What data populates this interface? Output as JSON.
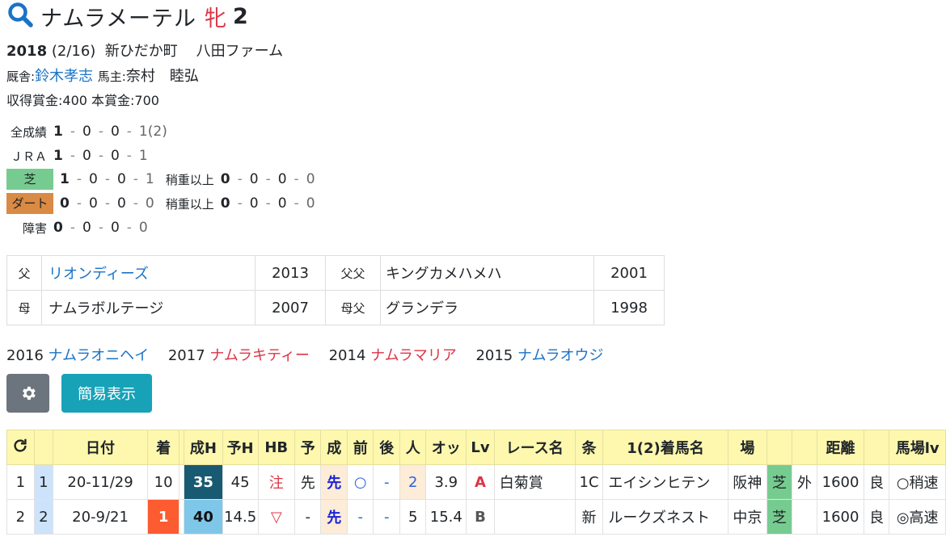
{
  "horse": {
    "name": "ナムラメーテル",
    "sex": "牝",
    "age": "2",
    "birth_year": "2018",
    "birth_date": "(2/16)",
    "birthplace": "新ひだか町",
    "breeder": "八田ファーム",
    "trainer_label": "厩舎:",
    "trainer": "鈴木孝志",
    "owner_label": "馬主:",
    "owner": "奈村　睦弘",
    "prize_line": "収得賞金:400 本賞金:700"
  },
  "records": [
    {
      "label": "全成績",
      "w": "1",
      "s": "0",
      "t": "0",
      "o": "1",
      "extra_o": " (2)"
    },
    {
      "label": "ＪＲＡ",
      "w": "1",
      "s": "0",
      "t": "0",
      "o": "1"
    },
    {
      "label": "芝",
      "w": "1",
      "s": "0",
      "t": "0",
      "o": "1",
      "sub_label": "稍重以上",
      "sw": "0",
      "ss": "0",
      "st": "0",
      "so": "0"
    },
    {
      "label": "ダート",
      "w": "0",
      "s": "0",
      "t": "0",
      "o": "0",
      "sub_label": "稍重以上",
      "sw": "0",
      "ss": "0",
      "st": "0",
      "so": "0"
    },
    {
      "label": "障害",
      "w": "0",
      "s": "0",
      "t": "0",
      "o": "0"
    }
  ],
  "pedigree": {
    "sire_label": "父",
    "sire": "リオンディーズ",
    "sire_year": "2013",
    "sire_sire_label": "父父",
    "sire_sire": "キングカメハメハ",
    "sire_sire_year": "2001",
    "dam_label": "母",
    "dam": "ナムラボルテージ",
    "dam_year": "2007",
    "dam_sire_label": "母父",
    "dam_sire": "グランデラ",
    "dam_sire_year": "1998"
  },
  "siblings": [
    {
      "year": "2016",
      "name": "ナムラオニヘイ",
      "color": "#1a73c7"
    },
    {
      "year": "2017",
      "name": "ナムラキティー",
      "color": "#dc3545"
    },
    {
      "year": "2014",
      "name": "ナムラマリア",
      "color": "#dc3545"
    },
    {
      "year": "2015",
      "name": "ナムラオウジ",
      "color": "#1a73c7"
    }
  ],
  "buttons": {
    "settings_icon": "gear-icon",
    "simple_view": "簡易表示"
  },
  "table": {
    "headers": [
      "日付",
      "着",
      "成H",
      "予H",
      "HB",
      "予",
      "成",
      "前",
      "後",
      "人",
      "オッ",
      "Lv",
      "レース名",
      "条",
      "1(2)着馬名",
      "場",
      "距離",
      "馬場lv"
    ],
    "rows": [
      {
        "no": "1",
        "rn": "1",
        "date": "20-11/29",
        "rank": "10",
        "seiH": "35",
        "yoH": "45",
        "hb": "注",
        "yo": "先",
        "sei": "先",
        "mae": "○",
        "ato": "-",
        "ninki": "2",
        "odds": "3.9",
        "lv": "A",
        "race": "白菊賞",
        "cond": "1C",
        "winner": "エイシンヒテン",
        "course": "阪神",
        "surface": "芝",
        "inout": "外",
        "dist": "1600",
        "going": "良",
        "baba": "○稍速"
      },
      {
        "no": "2",
        "rn": "2",
        "date": "20-9/21",
        "rank": "1",
        "seiH": "40",
        "yoH": "14.5",
        "hb": "▽",
        "yo": "-",
        "sei": "先",
        "mae": "-",
        "ato": "-",
        "ninki": "5",
        "odds": "15.4",
        "lv": "B",
        "race": "",
        "cond": "新",
        "winner": "ルークズネスト",
        "course": "中京",
        "surface": "芝",
        "inout": "",
        "dist": "1600",
        "going": "良",
        "baba": "◎高速"
      }
    ]
  },
  "colors": {
    "turf": "#76cc90",
    "dirt": "#d98a45",
    "accent": "#17a2b8",
    "header_bg": "#fdf8ad"
  }
}
